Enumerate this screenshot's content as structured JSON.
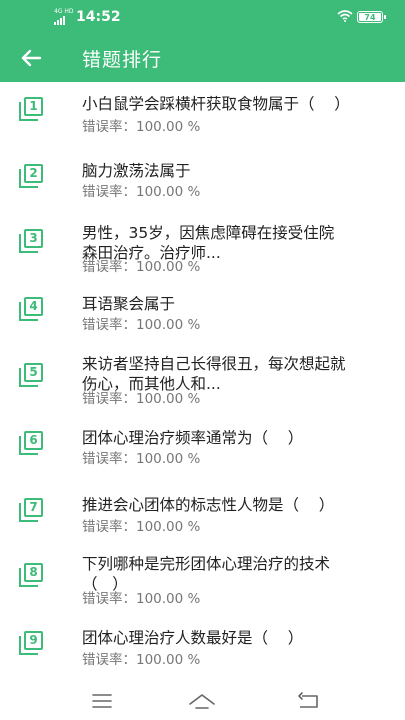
{
  "status": {
    "time": "14:52",
    "signal_label": "4G HD",
    "battery": "74"
  },
  "header": {
    "title": "错题排行"
  },
  "questions": [
    {
      "rank": "1",
      "text": "小白鼠学会踩横杆获取食物属于（    ）",
      "error_rate": "错误率：100.00 %"
    },
    {
      "rank": "2",
      "text": "脑力激荡法属于",
      "error_rate": "错误率：100.00 %"
    },
    {
      "rank": "3",
      "text": "男性，35岁，因焦虑障碍在接受住院\n森田治疗。治疗师...",
      "error_rate": "错误率：100.00 %"
    },
    {
      "rank": "4",
      "text": "耳语聚会属于",
      "error_rate": "错误率：100.00 %"
    },
    {
      "rank": "5",
      "text": "来访者坚持自己长得很丑，每次想起就\n伤心，而其他人和...",
      "error_rate": "错误率：100.00 %"
    },
    {
      "rank": "6",
      "text": "团体心理治疗频率通常为（    ）",
      "error_rate": "错误率：100.00 %"
    },
    {
      "rank": "7",
      "text": "推进会心团体的标志性人物是（    ）",
      "error_rate": "错误率：100.00 %"
    },
    {
      "rank": "8",
      "text": "下列哪种是完形团体心理治疗的技术\n（   ）",
      "error_rate": "错误率：100.00 %"
    },
    {
      "rank": "9",
      "text": "团体心理治疗人数最好是（    ）",
      "error_rate": "错误率：100.00 %"
    }
  ],
  "icons": {
    "back": "arrow-left-icon",
    "rank": "stacked-square-icon",
    "nav_menu": "menu-icon",
    "nav_home": "home-icon",
    "nav_back": "return-icon"
  },
  "colors": {
    "accent": "#3dbb78",
    "text": "#222222",
    "muted": "#777777"
  }
}
